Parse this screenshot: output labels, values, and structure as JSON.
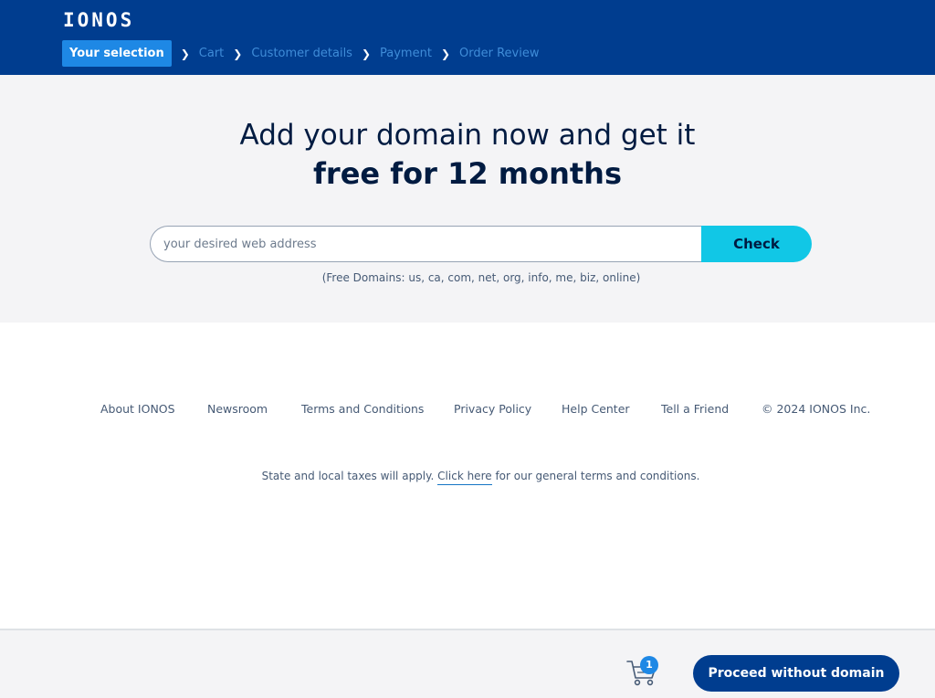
{
  "header": {
    "logo": "IONOS",
    "steps": [
      {
        "label": "Your selection",
        "active": true
      },
      {
        "label": "Cart",
        "active": false
      },
      {
        "label": "Customer details",
        "active": false
      },
      {
        "label": "Payment",
        "active": false
      },
      {
        "label": "Order Review",
        "active": false
      }
    ],
    "separator_icon": "chevron-right-icon"
  },
  "hero": {
    "title_line1": "Add your domain now and get it",
    "title_line2": "free for 12 months",
    "search_placeholder": "your desired web address",
    "search_value": "",
    "check_label": "Check",
    "free_domains_note": "(Free Domains: us, ca, com, net, org, info, me, biz, online)"
  },
  "footer": {
    "links": [
      "About IONOS",
      "Newsroom",
      "Terms and Conditions",
      "Privacy Policy",
      "Help Center",
      "Tell a Friend"
    ],
    "copyright": "© 2024 IONOS Inc.",
    "taxes_prefix": "State and local taxes will apply.",
    "taxes_link": "Click here",
    "taxes_suffix": "for our general terms and conditions."
  },
  "bottom_bar": {
    "cart_icon": "shopping-cart-icon",
    "cart_count": "1",
    "proceed_label": "Proceed without domain"
  },
  "colors": {
    "header_bg": "#003d8f",
    "active_step": "#1e88e5",
    "check_button": "#11c7e6",
    "hero_bg": "#f4f4f6",
    "text_dark": "#001b41"
  }
}
